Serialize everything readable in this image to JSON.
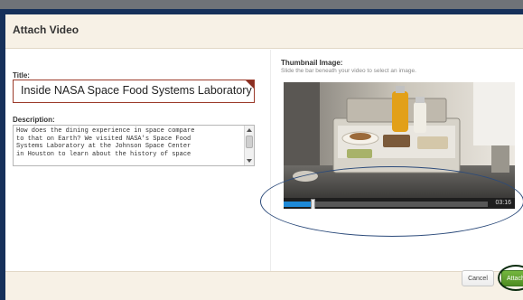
{
  "dialog": {
    "title": "Attach Video"
  },
  "form": {
    "title_label": "Title:",
    "title_value": "Inside NASA Space Food Systems Laboratory",
    "description_label": "Description:",
    "description_value": "How does the dining experience in space compare\nto that on Earth? We visited NASA's Space Food\nSystems Laboratory at the Johnson Space Center\nin Houston to learn about the history of space"
  },
  "thumbnail": {
    "label": "Thumbnail Image:",
    "hint": "Slide the bar beneath your video to select an image.",
    "duration": "03:16",
    "position_fraction": 0.14
  },
  "footer": {
    "cancel_label": "Cancel",
    "attach_label": "Attach"
  },
  "colors": {
    "header_border": "#16305a",
    "progress": "#1e8ad8",
    "attach_button": "#5a9a2a",
    "title_border": "#9b3a2a"
  },
  "icons": {
    "scroll_up": "scroll-up-arrow-icon",
    "scroll_down": "scroll-down-arrow-icon"
  }
}
